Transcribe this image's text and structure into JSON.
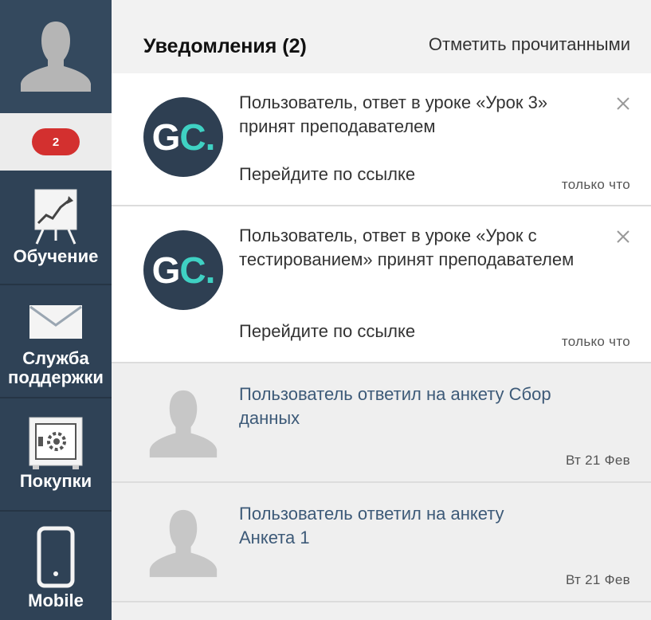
{
  "sidebar": {
    "badge_count": "2",
    "items": [
      {
        "label": "Обучение",
        "icon": "chart-board-icon"
      },
      {
        "label": "Служба поддержки",
        "icon": "envelope-icon"
      },
      {
        "label": "Покупки",
        "icon": "safe-icon"
      },
      {
        "label": "Mobile",
        "icon": "phone-icon"
      }
    ]
  },
  "header": {
    "title": "Уведомления (2)",
    "mark_read": "Отметить прочитанными"
  },
  "notifications": [
    {
      "text": "Пользователь, ответ в уроке «Урок 3» принят преподавателем",
      "link": "Перейдите по ссылке",
      "time": "только что",
      "avatar": "GC.",
      "unread": true
    },
    {
      "text": "Пользователь, ответ в уроке «Урок с тестированием» принят преподавателем",
      "link": "Перейдите по ссылке",
      "time": "только что",
      "avatar": "GC.",
      "unread": true
    },
    {
      "text": "Пользователь ответил на анкету Сбор данных",
      "time": "Вт 21 Фев",
      "avatar": "user-silhouette",
      "unread": false
    },
    {
      "text": "Пользователь ответил на анкету Анкета 1",
      "time": "Вт 21 Фев",
      "avatar": "user-silhouette",
      "unread": false
    }
  ],
  "colors": {
    "sidebar": "#2f4256",
    "badge": "#d3302f",
    "accent": "#3fd1c3"
  }
}
